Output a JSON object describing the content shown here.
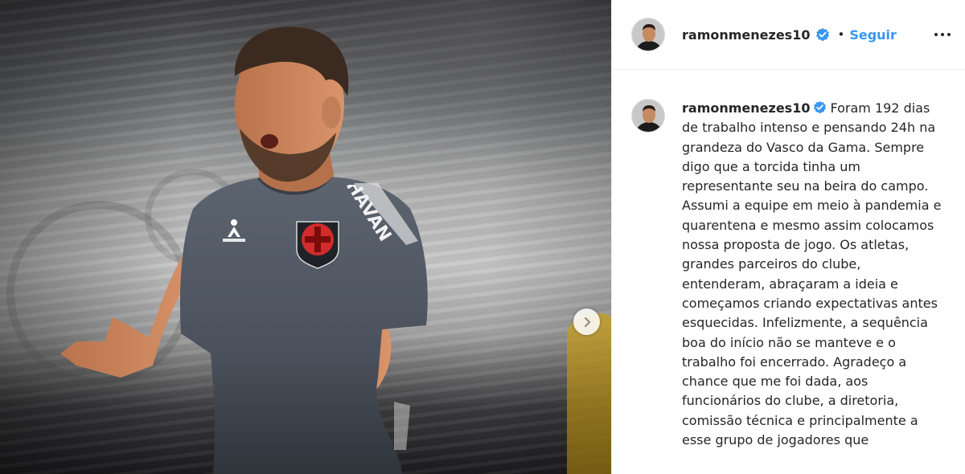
{
  "colors": {
    "follow_blue": "#3897f0",
    "verified_badge": "#3897f0",
    "text": "#262626",
    "border": "#efefef"
  },
  "photo": {
    "shirt_brand_text": "HAVAN",
    "next_icon": "chevron-right-icon"
  },
  "header": {
    "username": "ramonmenezes10",
    "separator": "•",
    "follow_label": "Seguir",
    "verified_icon": "verified-badge-icon",
    "more_icon": "more-options-icon"
  },
  "caption": {
    "username": "ramonmenezes10",
    "text": "Foram 192 dias de trabalho intenso e pensando 24h na grandeza do Vasco da Gama. Sempre digo que a torcida tinha um representante seu na beira do campo. Assumi a equipe em meio à pandemia e quarentena e mesmo assim colocamos nossa proposta de jogo. Os atletas, grandes parceiros do clube, entenderam, abraçaram a ideia e começamos criando expectativas antes esquecidas. Infelizmente, a sequência boa do início não se manteve e o trabalho foi encerrado. Agradeço a chance que me foi dada, aos funcionários do clube, a diretoria, comissão técnica e principalmente a esse grupo de jogadores que"
  }
}
